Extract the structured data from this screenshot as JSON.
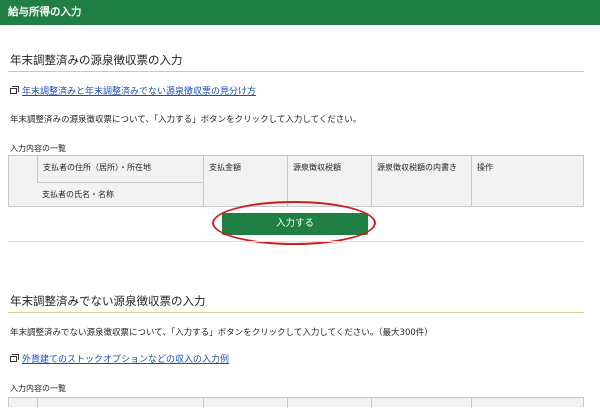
{
  "header": {
    "title": "給与所得の入力"
  },
  "section1": {
    "title": "年末調整済みの源泉徴収票の入力",
    "link": "年末調整済みと年末調整済みでない源泉徴収票の見分け方",
    "description": "年末調整済みの源泉徴収票について、「入力する」ボタンをクリックして入力してください。",
    "list_label": "入力内容の一覧",
    "table_headers": {
      "payer_address": "支払者の住所（居所）・所在地",
      "payer_name": "支払者の氏名・名称",
      "amount": "支払金額",
      "withholding": "源泉徴収税額",
      "withholding_detail": "源泉徴収税額の内書き",
      "operation": "操作"
    },
    "input_button": "入力する"
  },
  "section2": {
    "title": "年末調整済みでない源泉徴収票の入力",
    "description": "年末調整済みでない源泉徴収票について、「入力する」ボタンをクリックして入力してください。（最大300件）",
    "link": "外貨建てのストックオプションなどの収入の入力例",
    "list_label": "入力内容の一覧"
  },
  "colors": {
    "header_bg": "#1f7f44",
    "button_bg": "#1f7f44",
    "highlight": "#cc1f1f",
    "link": "#1a4fb3"
  }
}
